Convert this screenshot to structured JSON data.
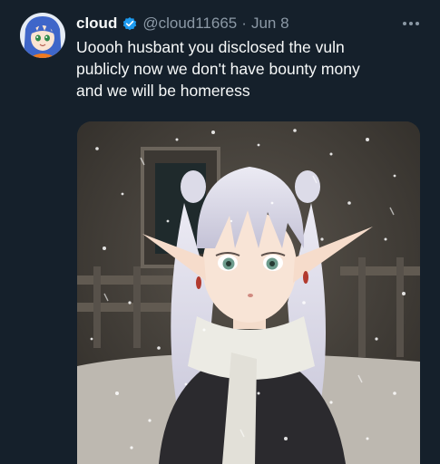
{
  "tweet": {
    "display_name": "cloud",
    "handle": "@cloud11665",
    "separator": "·",
    "date": "Jun 8",
    "text_lines": [
      "Uoooh husbant you disclosed the vuln",
      "publicly now we don't have bounty mony",
      "and we will be homeress"
    ],
    "icons": {
      "verified": "verified-badge-icon",
      "more": "more-options-icon"
    },
    "colors": {
      "background": "#15202b",
      "text": "#f7f9f9",
      "muted": "#8b98a5",
      "verified": "#1d9bf0"
    }
  }
}
